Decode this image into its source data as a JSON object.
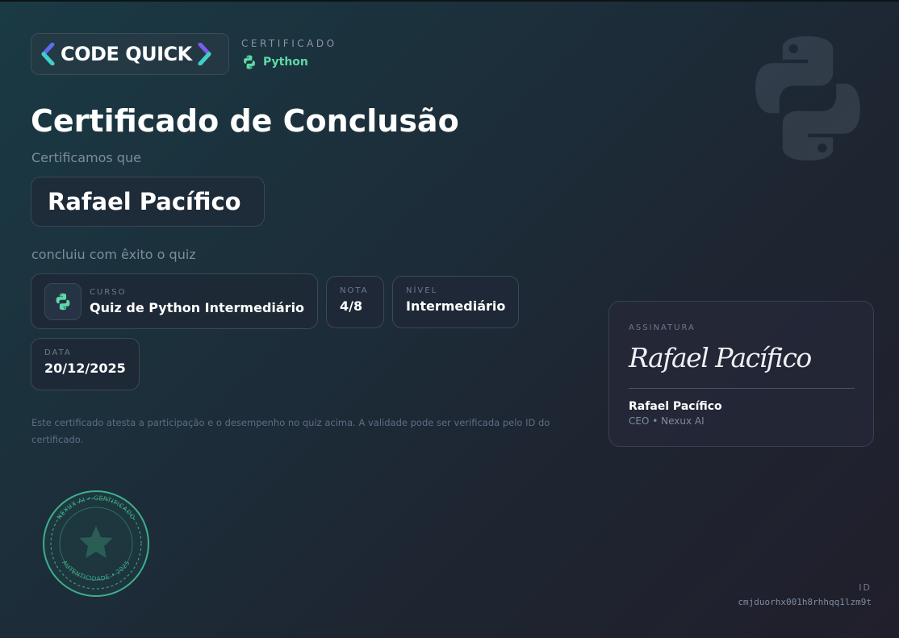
{
  "brand": {
    "logo_text": "CODE QUICK",
    "colors": {
      "left_chevron": "#5b6cf0",
      "right_chevron": "#7a5cf0",
      "accent": "#5ed8a8"
    }
  },
  "header": {
    "certificate_label": "CERTIFICADO",
    "language": "Python",
    "language_icon": "python-icon"
  },
  "main": {
    "title": "Certificado de Conclusão",
    "intro": "Certificamos que",
    "recipient": "Rafael Pacífico",
    "completed_text": "concluiu com êxito o quiz"
  },
  "details": {
    "course": {
      "label": "CURSO",
      "value": "Quiz de Python Intermediário"
    },
    "score": {
      "label": "NOTA",
      "value": "4/8"
    },
    "level": {
      "label": "NÍVEL",
      "value": "Intermediário"
    },
    "date": {
      "label": "DATA",
      "value": "20/12/2025"
    }
  },
  "disclaimer": "Este certificado atesta a participação e o desempenho no quiz acima. A validade pode ser verificada pelo ID do certificado.",
  "signature": {
    "label": "ASSINATURA",
    "script": "Rafael Pacífico",
    "name": "Rafael Pacífico",
    "role": "CEO • Nexux AI"
  },
  "seal": {
    "top_text": "NEXUX AI • CERTIFICADO",
    "bottom_text": "AUTENTICIDADE • 2025",
    "icon": "star-icon"
  },
  "certificate_id": {
    "label": "ID",
    "value": "cmjduorhx001h8rhhqq1lzm9t"
  }
}
